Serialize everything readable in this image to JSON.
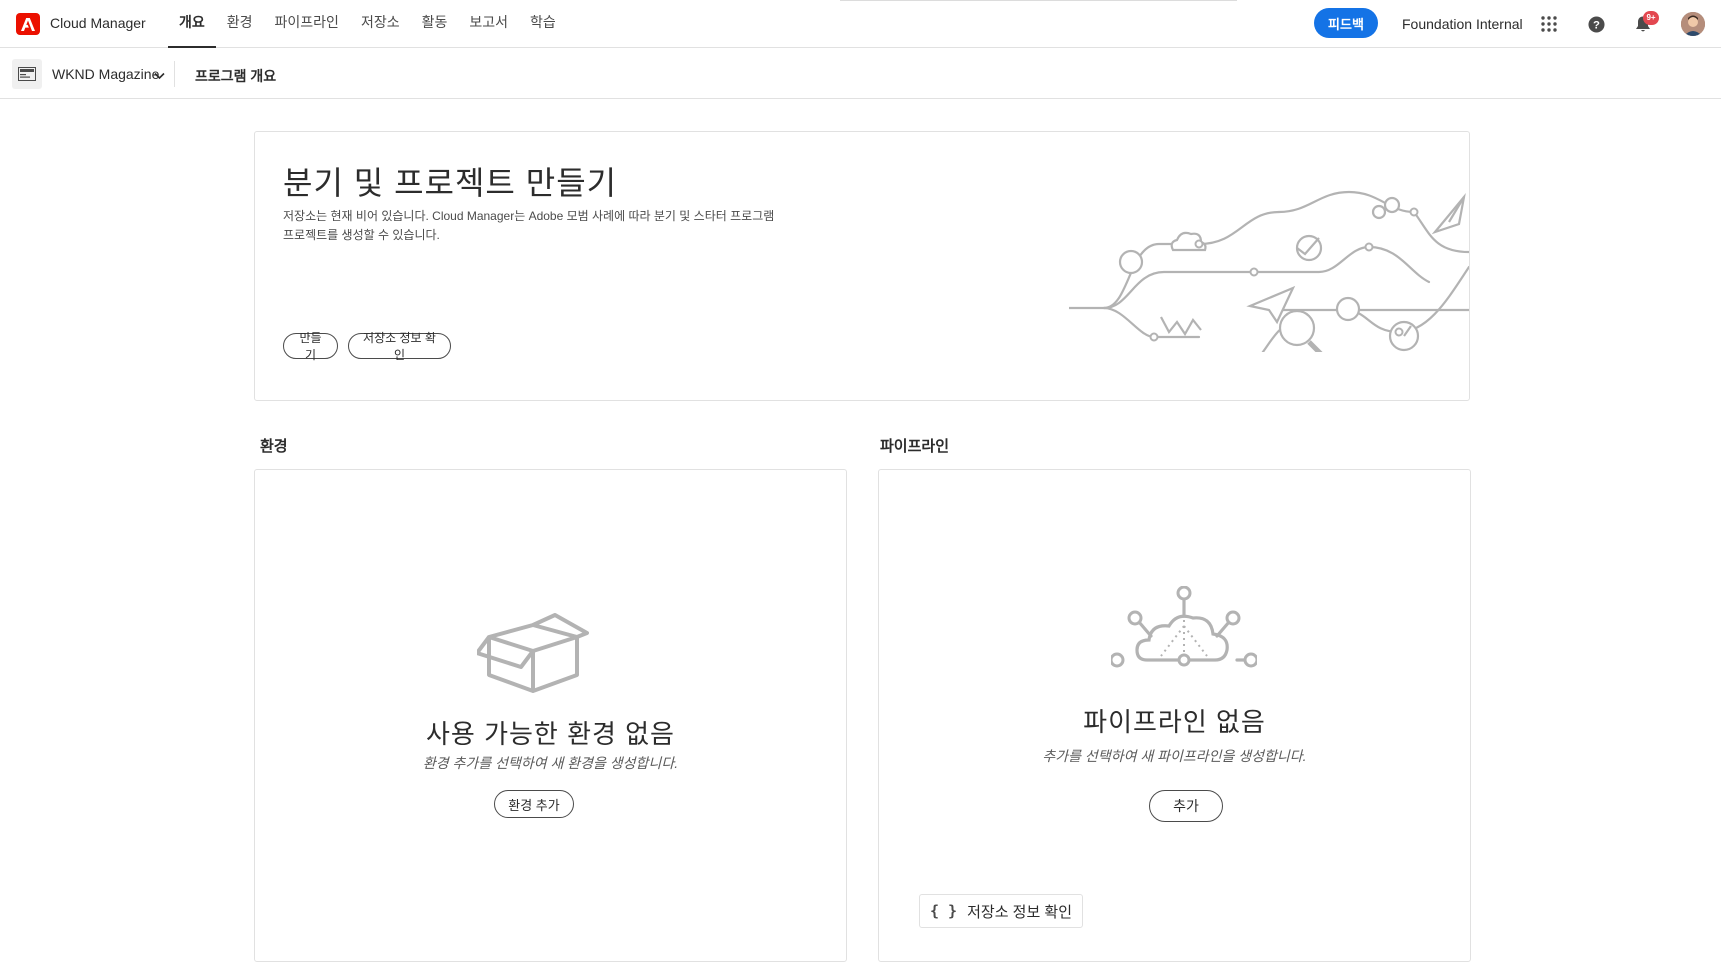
{
  "app": {
    "title": "Cloud Manager",
    "logo_icon": "adobe-logo-icon",
    "brand_color": "#eb1000"
  },
  "nav": {
    "items": [
      {
        "label": "개요",
        "active": true
      },
      {
        "label": "환경",
        "active": false
      },
      {
        "label": "파이프라인",
        "active": false
      },
      {
        "label": "저장소",
        "active": false
      },
      {
        "label": "활동",
        "active": false
      },
      {
        "label": "보고서",
        "active": false
      },
      {
        "label": "학습",
        "active": false
      }
    ]
  },
  "header": {
    "feedback_label": "피드백",
    "feedback_color": "#1473e6",
    "org_name": "Foundation Internal",
    "notification_badge": "9+",
    "badge_color": "#e34850",
    "icons": [
      "apps-grid-icon",
      "help-icon",
      "bell-icon",
      "user-avatar"
    ]
  },
  "subbar": {
    "program_name": "WKND Magazine",
    "page_title": "프로그램 개요"
  },
  "hero": {
    "title": "분기 및 프로젝트 만들기",
    "description": "저장소는 현재 비어 있습니다. Cloud Manager는 Adobe 모범 사례에 따라 분기 및 스타터 프로그램 프로젝트를 생성할 수 있습니다.",
    "create_label": "만들기",
    "repo_info_label": "저장소 정보 확인"
  },
  "environments": {
    "section_title": "환경",
    "empty_title": "사용 가능한 환경 없음",
    "empty_desc": "환경 추가를 선택하여 새 환경을 생성합니다.",
    "add_label": "환경 추가",
    "icon": "empty-box-icon"
  },
  "pipelines": {
    "section_title": "파이프라인",
    "empty_title": "파이프라인 없음",
    "empty_desc": "추가를 선택하여 새 파이프라인을 생성합니다.",
    "add_label": "추가",
    "repo_link_label": "저장소 정보 확인",
    "icon": "cloud-network-icon"
  }
}
